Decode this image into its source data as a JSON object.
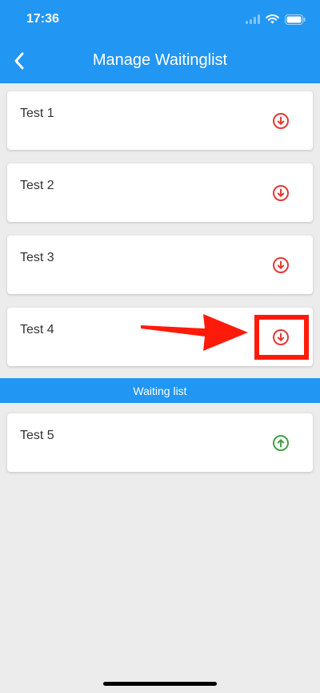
{
  "status_bar": {
    "time": "17:36",
    "icons": [
      "cellular-signal-icon",
      "wifi-icon",
      "battery-icon"
    ]
  },
  "app_bar": {
    "title": "Manage Waitinglist",
    "back_icon": "chevron-left-icon",
    "background_color": "#2196f3"
  },
  "active_list": [
    {
      "label": "Test 1",
      "action_icon": "arrow-down-circle-icon",
      "color": "#e53935"
    },
    {
      "label": "Test 2",
      "action_icon": "arrow-down-circle-icon",
      "color": "#e53935"
    },
    {
      "label": "Test 3",
      "action_icon": "arrow-down-circle-icon",
      "color": "#e53935"
    },
    {
      "label": "Test 4",
      "action_icon": "arrow-down-circle-icon",
      "color": "#e53935"
    }
  ],
  "waiting_section": {
    "header": "Waiting list",
    "items": [
      {
        "label": "Test 5",
        "action_icon": "arrow-up-circle-icon",
        "color": "#43a047"
      }
    ]
  },
  "annotation": {
    "color": "#ff1b0a",
    "target": "Test 4 move-down button"
  }
}
